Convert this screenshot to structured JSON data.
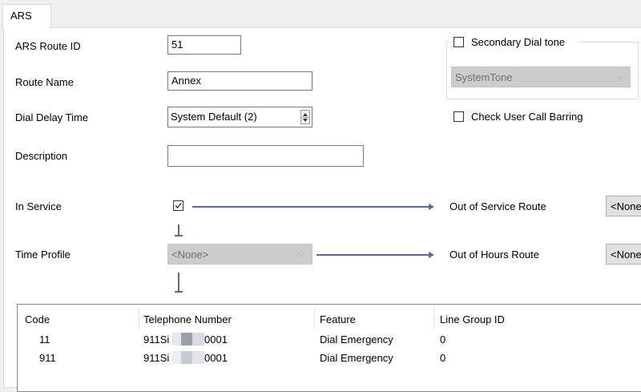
{
  "tabs": [
    {
      "label": "ARS",
      "active": true
    }
  ],
  "form": {
    "route_id_label": "ARS Route ID",
    "route_id_value": "51",
    "route_name_label": "Route Name",
    "route_name_value": "Annex",
    "dial_delay_label": "Dial Delay Time",
    "dial_delay_value": "System Default (2)",
    "description_label": "Description",
    "description_value": "",
    "in_service_label": "In Service",
    "in_service_checked": true,
    "out_of_service_label": "Out of Service Route",
    "out_of_service_value": "<None",
    "time_profile_label": "Time Profile",
    "time_profile_value": "<None>",
    "out_of_hours_label": "Out of Hours Route",
    "out_of_hours_value": "<None"
  },
  "secondary": {
    "dial_tone_label": "Secondary Dial tone",
    "dial_tone_checked": false,
    "tone_value": "SystemTone",
    "check_barring_label": "Check User Call Barring",
    "check_barring_checked": false
  },
  "table": {
    "columns": [
      "Code",
      "Telephone Number",
      "Feature",
      "Line Group ID"
    ],
    "rows": [
      {
        "code": "11",
        "number_prefix": "911Si",
        "number_suffix": "0001",
        "feature": "Dial Emergency",
        "line_group": "0"
      },
      {
        "code": "911",
        "number_prefix": "911Si",
        "number_suffix": "0001",
        "feature": "Dial Emergency",
        "line_group": "0"
      }
    ]
  },
  "colors": {
    "flow_arrow": "#5b6d87",
    "disabled_combo": "#cccccc",
    "panel_bg": "#ffffff",
    "chrome_bg": "#f0f0f0"
  }
}
